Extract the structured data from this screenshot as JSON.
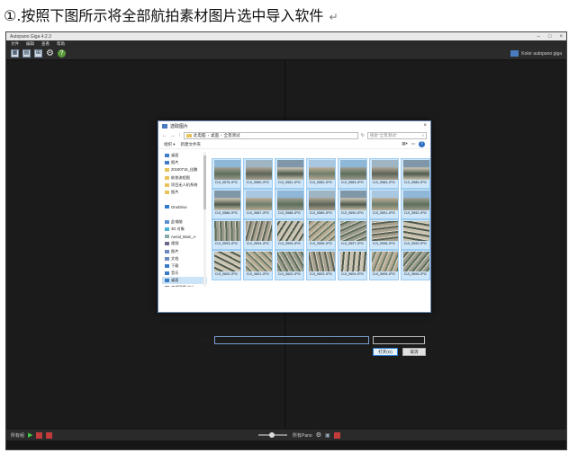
{
  "caption": {
    "text": "①.按照下图所示将全部航拍素材图片选中导入软件",
    "mark": "↵"
  },
  "app": {
    "title": "Autopano Giga 4.2.3",
    "menu": [
      "文件",
      "编辑",
      "查看",
      "帮助"
    ],
    "brand": "Kolor autopano giga",
    "bottom": {
      "left_label": "所有组",
      "right_label": "所有Pano"
    }
  },
  "dialog": {
    "title": "选取图片",
    "breadcrumb": [
      "此电脑",
      "桌面",
      "全景测试"
    ],
    "search_placeholder": "搜索\"全景测试\"",
    "organize": "组织 ▾",
    "new_folder": "新建文件夹",
    "nav_items": [
      {
        "label": "桌面",
        "color": "#3d7cc9"
      },
      {
        "label": "图片",
        "color": "#3d7cc9"
      },
      {
        "label": "20180716_佳鹏",
        "color": "#e8c25a"
      },
      {
        "label": "航拍流程图",
        "color": "#e8c25a"
      },
      {
        "label": "项目无人机系统",
        "color": "#e8c25a"
      },
      {
        "label": "图片",
        "color": "#e8c25a"
      },
      {
        "label": "",
        "color": "#ffffff"
      },
      {
        "label": "OneDrive",
        "color": "#2f7bd1"
      },
      {
        "label": "",
        "color": "#ffffff"
      },
      {
        "label": "此电脑",
        "color": "#5b8fcf"
      },
      {
        "label": "3D 对象",
        "color": "#4ab0d8"
      },
      {
        "label": "Aerial_Main_A",
        "color": "#8aa"
      },
      {
        "label": "视频",
        "color": "#6a6a8a"
      },
      {
        "label": "图片",
        "color": "#6a8abf"
      },
      {
        "label": "文档",
        "color": "#6a8abf"
      },
      {
        "label": "下载",
        "color": "#3a7bc8"
      },
      {
        "label": "音乐",
        "color": "#3a7bc8"
      },
      {
        "label": "桌面",
        "color": "#3a7bc8",
        "selected": true
      },
      {
        "label": "本地磁盘 (C:)",
        "color": "#888"
      }
    ],
    "files": [
      "DJI_0576.JPG",
      "DJI_0580.JPG",
      "DJI_0581.JPG",
      "DJI_0582.JPG",
      "DJI_0583.JPG",
      "DJI_0584.JPG",
      "DJI_0585.JPG",
      "DJI_0586.JPG",
      "DJI_0587.JPG",
      "DJI_0588.JPG",
      "DJI_0589.JPG",
      "DJI_0590.JPG",
      "DJI_0591.JPG",
      "DJI_0592.JPG",
      "DJI_0593.JPG",
      "DJI_0594.JPG",
      "DJI_0595.JPG",
      "DJI_0596.JPG",
      "DJI_0597.JPG",
      "DJI_0598.JPG",
      "DJI_0599.JPG",
      "DJI_0600.JPG",
      "DJI_0601.JPG",
      "DJI_0602.JPG",
      "DJI_0603.JPG",
      "DJI_0604.JPG",
      "DJI_0605.JPG",
      "DJI_0606.JPG"
    ],
    "filename_label": "文件名(N):",
    "filename_value": "\"DJI_0576.JPG\" \"DJI_0580.JPG\" \"DJI_0581.JPG\" \"DJI_0582.JPG\" \"DJI_0583.JPG\" \"DJI_0584.J",
    "filetype": "所有图片 (*.*)",
    "open_button": "打开(O)",
    "cancel_button": "取消"
  },
  "colors": {
    "app_bg": "#1b1b1b",
    "selection": "#cde6fa",
    "accent": "#2b7bd3"
  }
}
